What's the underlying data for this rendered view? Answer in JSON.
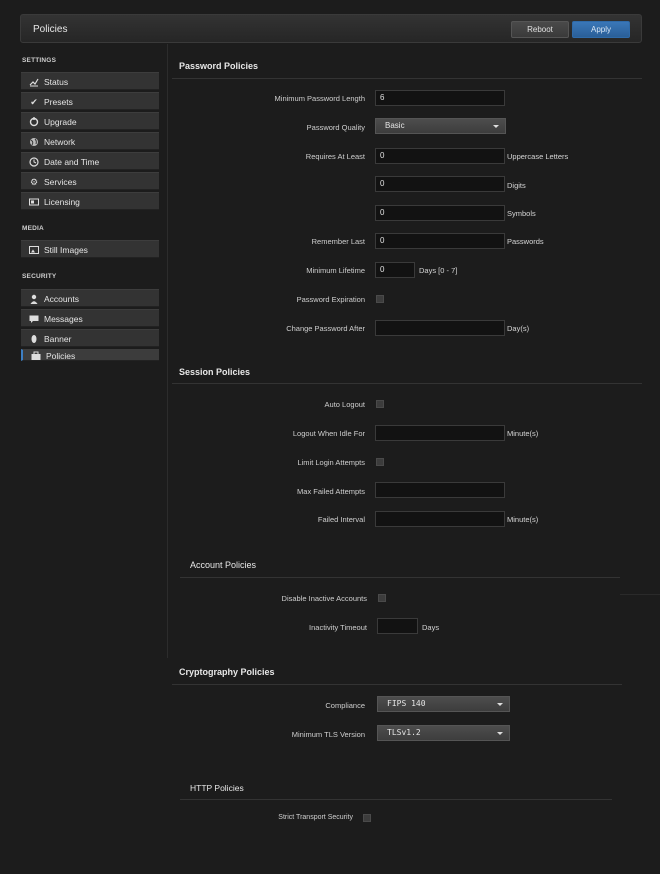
{
  "header": {
    "title": "Policies",
    "reboot_label": "Reboot",
    "apply_label": "Apply"
  },
  "sidebar": {
    "settings_head": "SETTINGS",
    "media_head": "MEDIA",
    "security_head": "SECURITY",
    "settings_items": [
      {
        "label": "Status",
        "icon": "chart-icon"
      },
      {
        "label": "Presets",
        "icon": "check-icon"
      },
      {
        "label": "Upgrade",
        "icon": "upgrade-icon"
      },
      {
        "label": "Network",
        "icon": "globe-icon"
      },
      {
        "label": "Date and Time",
        "icon": "clock-icon"
      },
      {
        "label": "Services",
        "icon": "gear-icon"
      },
      {
        "label": "Licensing",
        "icon": "license-icon"
      }
    ],
    "media_items": [
      {
        "label": "Still Images",
        "icon": "image-icon"
      }
    ],
    "security_items": [
      {
        "label": "Accounts",
        "icon": "user-icon"
      },
      {
        "label": "Messages",
        "icon": "message-icon"
      },
      {
        "label": "Banner",
        "icon": "banner-icon"
      },
      {
        "label": "Policies",
        "icon": "briefcase-icon"
      }
    ]
  },
  "password": {
    "title": "Password Policies",
    "min_length_label": "Minimum Password Length",
    "min_length": "6",
    "quality_label": "Password Quality",
    "quality": "Basic",
    "requires_label": "Requires At Least",
    "uppercase": "0",
    "uppercase_suffix": "Uppercase Letters",
    "digits": "0",
    "digits_suffix": "Digits",
    "symbols": "0",
    "symbols_suffix": "Symbols",
    "remember_label": "Remember Last",
    "remember": "0",
    "remember_suffix": "Passwords",
    "min_lifetime_label": "Minimum Lifetime",
    "min_lifetime": "0",
    "min_lifetime_suffix": "Days [0 - 7]",
    "expiration_label": "Password Expiration",
    "change_after_label": "Change Password After",
    "change_after": "",
    "change_after_suffix": "Day(s)"
  },
  "session": {
    "title": "Session Policies",
    "auto_logout_label": "Auto Logout",
    "idle_label": "Logout When Idle For",
    "idle": "",
    "idle_suffix": "Minute(s)",
    "limit_login_label": "Limit Login Attempts",
    "max_failed_label": "Max Failed Attempts",
    "max_failed": "",
    "failed_interval_label": "Failed Interval",
    "failed_interval": "",
    "failed_interval_suffix": "Minute(s)"
  },
  "account": {
    "title": "Account Policies",
    "disable_inactive_label": "Disable Inactive Accounts",
    "inactivity_label": "Inactivity Timeout",
    "inactivity": "",
    "inactivity_suffix": "Days"
  },
  "crypto": {
    "title": "Cryptography Policies",
    "compliance_label": "Compliance",
    "compliance": "FIPS 140",
    "tls_label": "Minimum TLS Version",
    "tls": "TLSv1.2"
  },
  "http": {
    "title": "HTTP Policies",
    "sts_label": "Strict Transport Security"
  }
}
